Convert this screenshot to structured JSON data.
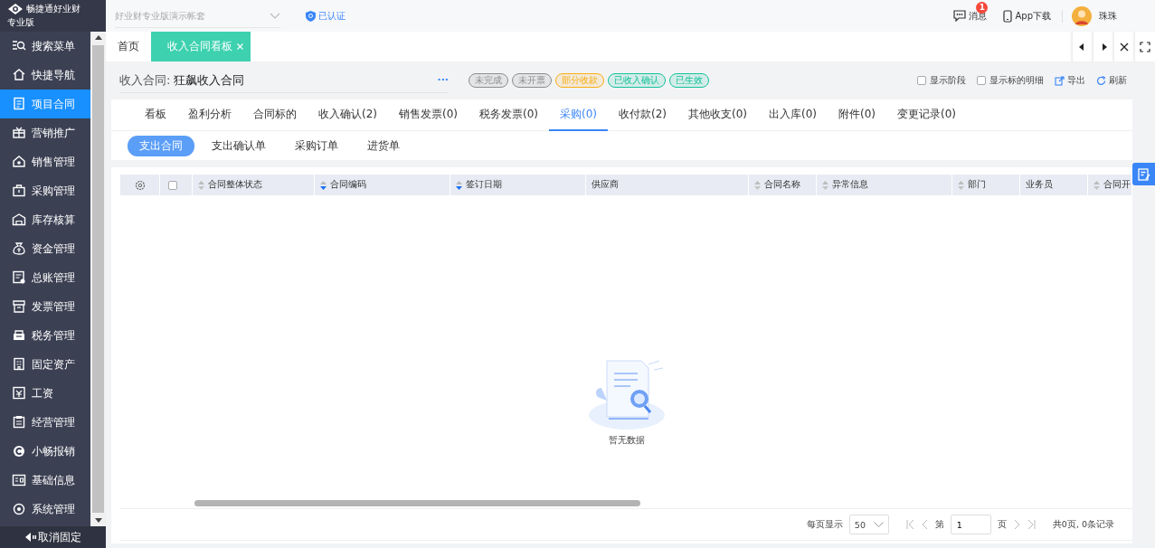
{
  "brand": {
    "name": "畅捷通好业财",
    "edition": "专业版"
  },
  "topbar": {
    "account": {
      "placeholder": "好业财专业版演示帐套"
    },
    "verified": "已认证",
    "messages": {
      "label": "消息",
      "badge": "1"
    },
    "app_download": "App下载",
    "user": "珠珠"
  },
  "sidebar": {
    "items": [
      {
        "label": "搜索菜单",
        "selected": false
      },
      {
        "label": "快捷导航",
        "selected": false
      },
      {
        "label": "项目合同",
        "selected": true
      },
      {
        "label": "营销推广",
        "selected": false
      },
      {
        "label": "销售管理",
        "selected": false
      },
      {
        "label": "采购管理",
        "selected": false
      },
      {
        "label": "库存核算",
        "selected": false
      },
      {
        "label": "资金管理",
        "selected": false
      },
      {
        "label": "总账管理",
        "selected": false
      },
      {
        "label": "发票管理",
        "selected": false
      },
      {
        "label": "税务管理",
        "selected": false
      },
      {
        "label": "固定资产",
        "selected": false
      },
      {
        "label": "工资",
        "selected": false
      },
      {
        "label": "经营管理",
        "selected": false
      },
      {
        "label": "小畅报销",
        "selected": false
      },
      {
        "label": "基础信息",
        "selected": false
      },
      {
        "label": "系统管理",
        "selected": false
      }
    ],
    "unpin": "取消固定"
  },
  "page_tabs": [
    {
      "label": "首页",
      "selected": false,
      "closable": false
    },
    {
      "label": "收入合同看板",
      "selected": true,
      "closable": true
    }
  ],
  "header": {
    "label": "收入合同:",
    "title": "狂飙收入合同",
    "more": "···",
    "tags": [
      {
        "label": "未完成",
        "color": "#8c8c8c"
      },
      {
        "label": "未开票",
        "color": "#8c8c8c"
      },
      {
        "label": "部分收款",
        "color": "#faad14"
      },
      {
        "label": "已收入确认",
        "color": "#13c29a"
      },
      {
        "label": "已生效",
        "color": "#13c29a"
      }
    ],
    "options": [
      {
        "label": "显示阶段",
        "checked": false
      },
      {
        "label": "显示标的明细",
        "checked": false
      }
    ],
    "export": "导出",
    "refresh": "刷新"
  },
  "tabs": [
    {
      "label": "看板",
      "selected": false
    },
    {
      "label": "盈利分析",
      "selected": false
    },
    {
      "label": "合同标的",
      "selected": false
    },
    {
      "label": "收入确认(2)",
      "selected": false
    },
    {
      "label": "销售发票(0)",
      "selected": false
    },
    {
      "label": "税务发票(0)",
      "selected": false
    },
    {
      "label": "采购(0)",
      "selected": true
    },
    {
      "label": "收付款(2)",
      "selected": false
    },
    {
      "label": "其他收支(0)",
      "selected": false
    },
    {
      "label": "出入库(0)",
      "selected": false
    },
    {
      "label": "附件(0)",
      "selected": false
    },
    {
      "label": "变更记录(0)",
      "selected": false
    }
  ],
  "sub_tabs": [
    {
      "label": "支出合同",
      "selected": true
    },
    {
      "label": "支出确认单",
      "selected": false
    },
    {
      "label": "采购订单",
      "selected": false
    },
    {
      "label": "进货单",
      "selected": false
    }
  ],
  "table": {
    "select_all": {
      "checked": false
    },
    "columns": [
      {
        "label": "合同整体状态",
        "sortable": true,
        "sorted": false
      },
      {
        "label": "合同编码",
        "sortable": true,
        "sorted": true
      },
      {
        "label": "签订日期",
        "sortable": true,
        "sorted": true
      },
      {
        "label": "供应商",
        "sortable": false
      },
      {
        "label": "合同名称",
        "sortable": true,
        "sorted": false
      },
      {
        "label": "异常信息",
        "sortable": true,
        "sorted": false
      },
      {
        "label": "部门",
        "sortable": true,
        "sorted": false
      },
      {
        "label": "业务员",
        "sortable": false
      },
      {
        "label": "合同开",
        "sortable": true,
        "sorted": false
      }
    ],
    "empty": "暂无数据"
  },
  "pagination": {
    "page_size_label": "每页显示",
    "page_size": "50",
    "page_prefix": "第",
    "page": "1",
    "page_suffix": "页",
    "summary": "共0页, 0条记录"
  }
}
